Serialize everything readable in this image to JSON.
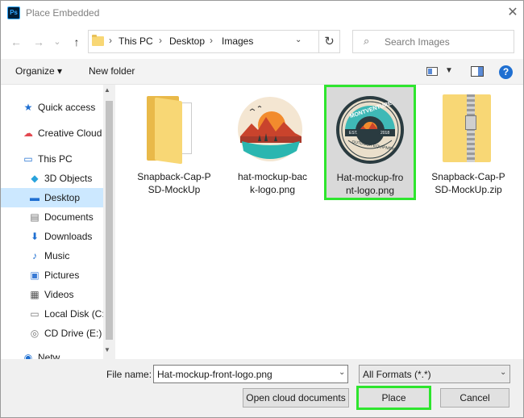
{
  "window": {
    "title": "Place Embedded",
    "app_icon_text": "Ps",
    "close_glyph": "✕"
  },
  "nav": {
    "back_glyph": "←",
    "forward_glyph": "→",
    "dropdown_glyph": "⌄",
    "up_glyph": "↑",
    "breadcrumbs": [
      "This PC",
      "Desktop",
      "Images"
    ],
    "separator": "›",
    "refresh_glyph": "↻",
    "search_placeholder": "Search Images"
  },
  "toolbar": {
    "organize_label": "Organize ▾",
    "new_folder_label": "New folder",
    "help_glyph": "?"
  },
  "sidebar": {
    "items": [
      {
        "label": "Quick access",
        "icon": "star-icon",
        "glyph": "★",
        "color": "#1f6fd1",
        "selected": false
      },
      {
        "label": "Creative Cloud",
        "icon": "creative-cloud-icon",
        "glyph": "☁",
        "color": "#e34850",
        "selected": false
      },
      {
        "label": "This PC",
        "icon": "computer-icon",
        "glyph": "▭",
        "color": "#1f6fd1",
        "selected": false
      },
      {
        "label": "3D Objects",
        "icon": "cube-icon",
        "glyph": "◆",
        "color": "#29a3dc",
        "selected": false
      },
      {
        "label": "Desktop",
        "icon": "desktop-icon",
        "glyph": "▬",
        "color": "#1f6fd1",
        "selected": true
      },
      {
        "label": "Documents",
        "icon": "document-icon",
        "glyph": "▤",
        "color": "#6f6f6f",
        "selected": false
      },
      {
        "label": "Downloads",
        "icon": "download-icon",
        "glyph": "⬇",
        "color": "#1f6fd1",
        "selected": false
      },
      {
        "label": "Music",
        "icon": "music-icon",
        "glyph": "♪",
        "color": "#1f6fd1",
        "selected": false
      },
      {
        "label": "Pictures",
        "icon": "pictures-icon",
        "glyph": "▣",
        "color": "#3a7bd5",
        "selected": false
      },
      {
        "label": "Videos",
        "icon": "video-icon",
        "glyph": "▦",
        "color": "#555555",
        "selected": false
      },
      {
        "label": "Local Disk (C:",
        "icon": "disk-icon",
        "glyph": "▭",
        "color": "#777777",
        "selected": false
      },
      {
        "label": "CD Drive (E:)",
        "icon": "cd-icon",
        "glyph": "◎",
        "color": "#777777",
        "selected": false
      },
      {
        "label": "Netw...",
        "icon": "network-icon",
        "glyph": "◉",
        "color": "#1f6fd1",
        "selected": false
      }
    ],
    "scroll_up_glyph": "▲",
    "scroll_down_glyph": "▼"
  },
  "files": [
    {
      "name_line1": "Snapback-Cap-P",
      "name_line2": "SD-MockUp",
      "kind": "folder",
      "icon": "folder-icon",
      "selected": false
    },
    {
      "name_line1": "hat-mockup-bac",
      "name_line2": "k-logo.png",
      "kind": "image",
      "icon": "sunset-logo-icon",
      "selected": false
    },
    {
      "name_line1": "Hat-mockup-fro",
      "name_line2": "nt-logo.png",
      "kind": "image",
      "icon": "montventure-logo-icon",
      "selected": true,
      "logo_text": "MONTVENTURE",
      "logo_subtext": "OUTDOOR EQUIPMENT",
      "logo_est": "EST.",
      "logo_year": "2018"
    },
    {
      "name_line1": "Snapback-Cap-P",
      "name_line2": "SD-MockUp.zip",
      "kind": "zip",
      "icon": "zip-folder-icon",
      "selected": false
    }
  ],
  "bottom": {
    "file_name_label": "File name:",
    "file_name_value": "Hat-mockup-front-logo.png",
    "format_value": "All Formats (*.*)",
    "dropdown_glyph": "⌄",
    "open_cloud_label": "Open cloud documents",
    "place_label": "Place",
    "cancel_label": "Cancel"
  },
  "colors": {
    "highlight": "#2ee52e",
    "selection": "#cce8ff",
    "accent": "#1f6fd1"
  }
}
